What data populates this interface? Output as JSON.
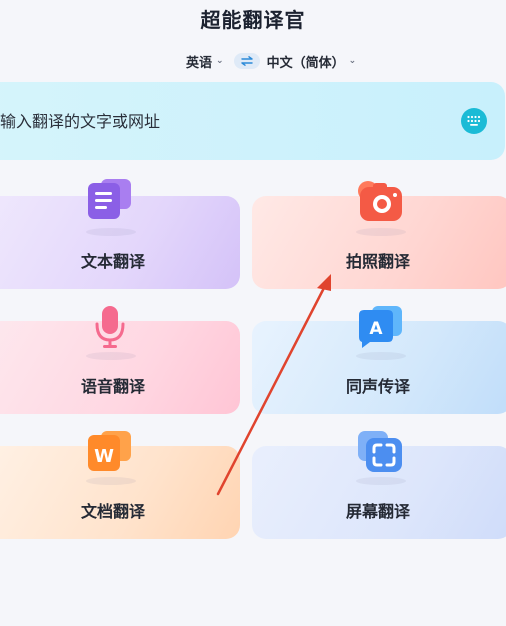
{
  "app": {
    "title": "超能翻译官"
  },
  "language_bar": {
    "source": "英语",
    "target": "中文（简体）"
  },
  "search": {
    "placeholder": "输入翻译的文字或网址"
  },
  "features": [
    {
      "label": "文本翻译",
      "icon": "document-text-icon"
    },
    {
      "label": "拍照翻译",
      "icon": "camera-icon"
    },
    {
      "label": "语音翻译",
      "icon": "microphone-icon"
    },
    {
      "label": "同声传译",
      "icon": "speech-bubble-a-icon"
    },
    {
      "label": "文档翻译",
      "icon": "word-document-icon"
    },
    {
      "label": "屏幕翻译",
      "icon": "screen-capture-icon"
    }
  ],
  "colors": {
    "accent": "#1bbbd6",
    "text_card": "#e3d6fb",
    "photo_card": "#ffd2cf",
    "voice_card": "#ffd7e2",
    "interpret_card": "#d3e8fb",
    "doc_card": "#ffe3cc",
    "screen_card": "#dde6fb",
    "annotation_arrow": "#e0442e"
  }
}
